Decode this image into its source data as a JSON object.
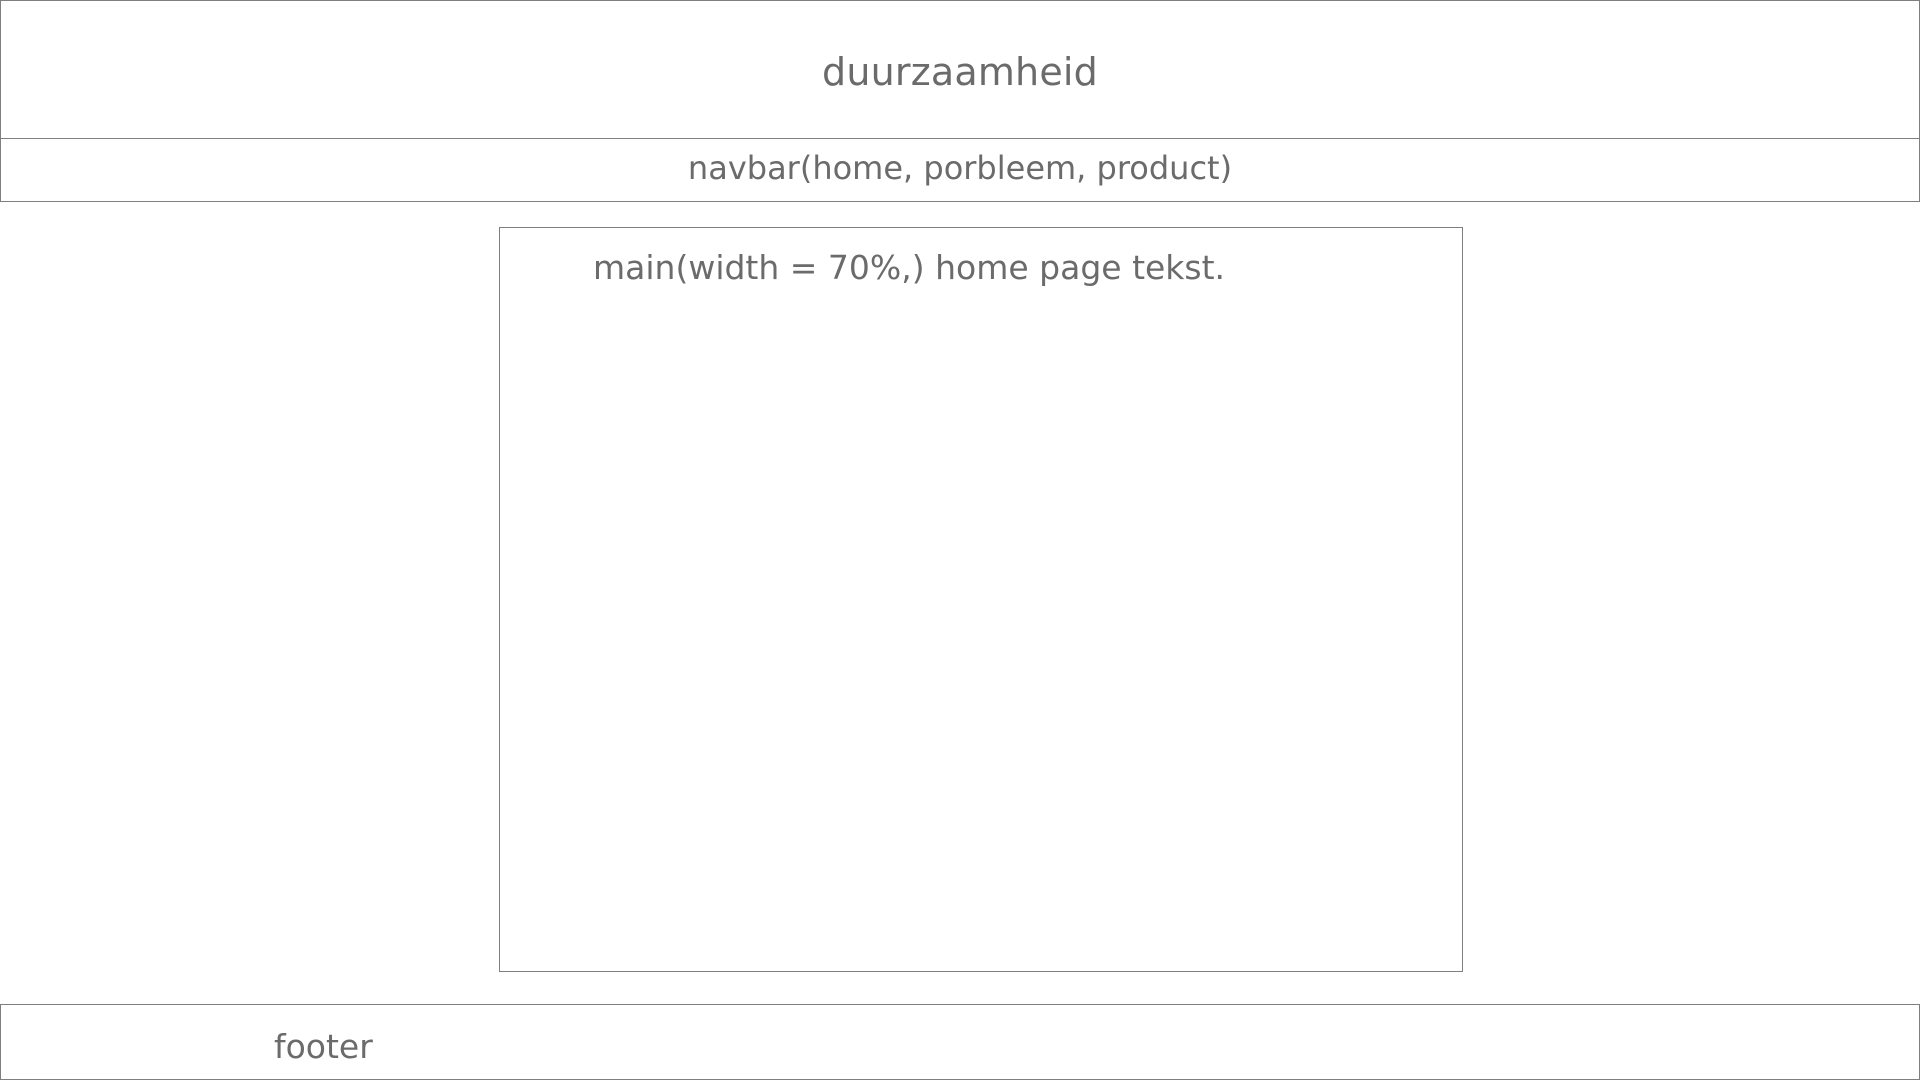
{
  "header": {
    "title": "duurzaamheid"
  },
  "navbar": {
    "label": "navbar(home, porbleem, product)"
  },
  "main": {
    "label": "main(width = 70%,) home page tekst."
  },
  "footer": {
    "label": "footer"
  },
  "colors": {
    "border": "#7f7f7f",
    "text": "#6b6b6b",
    "background": "#ffffff"
  }
}
